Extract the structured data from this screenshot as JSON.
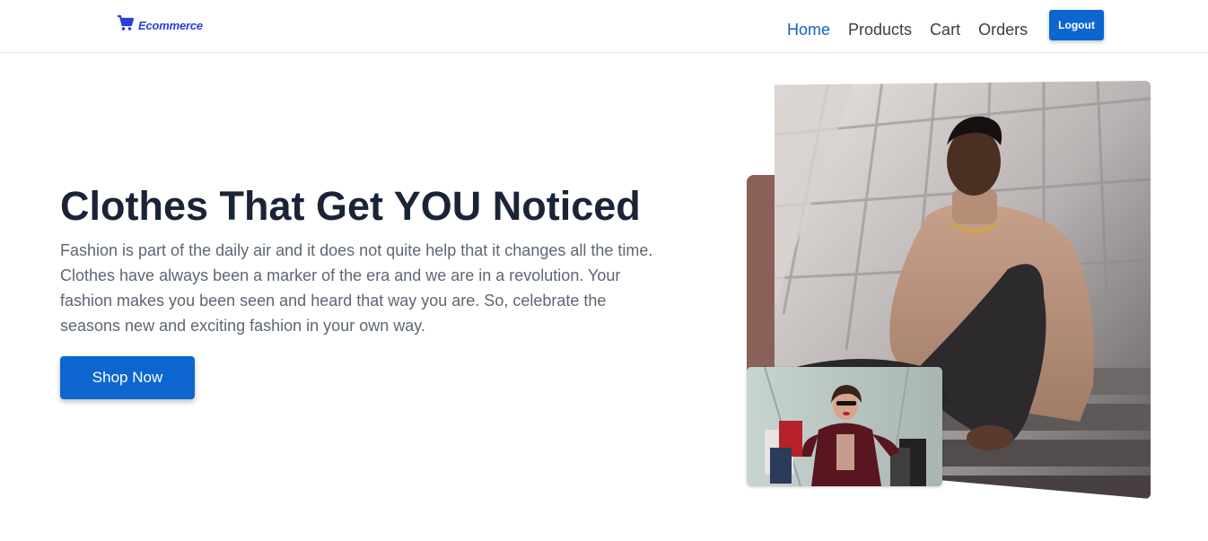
{
  "navbar": {
    "brand": {
      "icon": "cart-icon",
      "text": "Ecommerce"
    },
    "links": [
      {
        "label": "Home",
        "active": true
      },
      {
        "label": "Products",
        "active": false
      },
      {
        "label": "Cart",
        "active": false
      },
      {
        "label": "Orders",
        "active": false
      }
    ],
    "logout_label": "Logout"
  },
  "hero": {
    "title": "Clothes That Get YOU Noticed",
    "description": "Fashion is part of the daily air and it does not quite help that it changes all the time. Clothes have always been a marker of the era and we are in a revolution. Your fashion makes you been seen and heard that way you are. So, celebrate the seasons new and exciting fashion in your own way.",
    "cta_label": "Shop Now"
  },
  "images": {
    "main": "man-in-beige-turtleneck-photo",
    "secondary": "woman-with-shopping-bags-photo"
  },
  "colors": {
    "primary": "#0d66d0",
    "active_link": "#1560c6",
    "brand": "#2a3fd6",
    "title": "#1b2436",
    "body_text": "#5d6673",
    "accent_block": "#8a6058"
  }
}
